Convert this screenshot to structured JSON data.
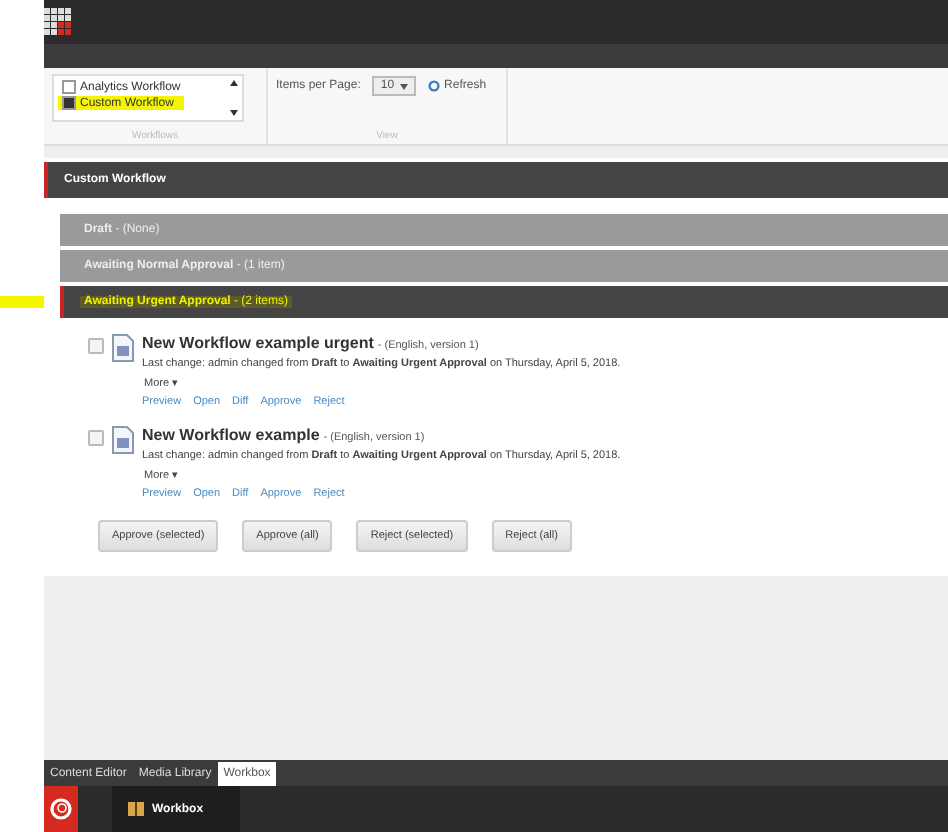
{
  "ribbon": {
    "workflows": [
      {
        "label": "Analytics Workflow",
        "checked": false,
        "highlighted": false
      },
      {
        "label": "Custom Workflow",
        "checked": true,
        "highlighted": true
      }
    ],
    "workflows_group": "Workflows",
    "items_per_page_label": "Items per Page:",
    "items_per_page": "10",
    "refresh": "Refresh",
    "view_group": "View"
  },
  "workflow_title": "Custom Workflow",
  "states": [
    {
      "label": "Draft",
      "count": "- (None)",
      "expanded": false,
      "highlighted": false
    },
    {
      "label": "Awaiting Normal Approval",
      "count": "- (1 item)",
      "expanded": false,
      "highlighted": false
    },
    {
      "label": "Awaiting Urgent Approval",
      "count": "- (2 items)",
      "expanded": true,
      "highlighted": true
    }
  ],
  "items": [
    {
      "title": "New Workflow example urgent",
      "meta": "- (English, version 1)",
      "checked": false,
      "change": "Last change: admin changed from **Draft** to **Awaiting Urgent Approval** on Thursday, April 5, 2018.",
      "more": "More ▾",
      "actions": [
        "Preview",
        "Open",
        "Diff",
        "Approve",
        "Reject"
      ]
    },
    {
      "title": "New Workflow example",
      "meta": "- (English, version 1)",
      "checked": false,
      "change": "Last change: admin changed from **Draft** to **Awaiting Urgent Approval** on Thursday, April 5, 2018.",
      "more": "More ▾",
      "actions": [
        "Preview",
        "Open",
        "Diff",
        "Approve",
        "Reject"
      ]
    }
  ],
  "buttons": [
    "Approve (selected)",
    "Approve (all)",
    "Reject (selected)",
    "Reject (all)"
  ],
  "bottom_tabs": [
    {
      "label": "Content Editor",
      "selected": false
    },
    {
      "label": "Media Library",
      "selected": false
    },
    {
      "label": "Workbox",
      "selected": true
    }
  ],
  "taskbar": {
    "app": "Workbox"
  }
}
